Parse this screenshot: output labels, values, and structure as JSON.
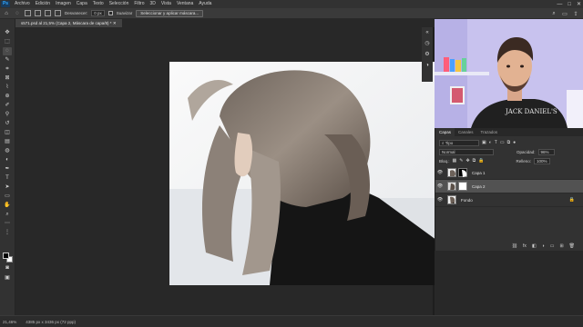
{
  "app": {
    "logo": "Ps"
  },
  "menubar": {
    "items": [
      "Archivo",
      "Edición",
      "Imagen",
      "Capa",
      "Texto",
      "Selección",
      "Filtro",
      "3D",
      "Vista",
      "Ventana",
      "Ayuda"
    ]
  },
  "options": {
    "difuminar_label": "Desvanecer:",
    "difuminar_value": "0 px",
    "suavizar_label": "Suavizar",
    "select_mask_label": "Seleccionar y aplicar máscara..."
  },
  "document": {
    "tab_title": "s571.psd al 21,5% (Capa 2, Máscara de capa/8) *"
  },
  "layers_panel": {
    "tabs": [
      "Capas",
      "Canales",
      "Trazados"
    ],
    "filter_label": "Tipo",
    "blend_mode": "Normal",
    "opacity_label": "Opacidad:",
    "opacity_value": "96%",
    "lock_label": "Bloq.:",
    "fill_label": "Relleno:",
    "fill_value": "100%",
    "layers": [
      {
        "name": "Capa 1",
        "selected": false
      },
      {
        "name": "Capa 2",
        "selected": true
      },
      {
        "name": "Fondo",
        "selected": false
      }
    ]
  },
  "status": {
    "zoom": "21,46%",
    "doc_info": "4385 px x 3436 px (72 ppp)"
  },
  "colors": {
    "accent": "#31a8ff",
    "panel": "#323232",
    "canvas": "#282828"
  }
}
